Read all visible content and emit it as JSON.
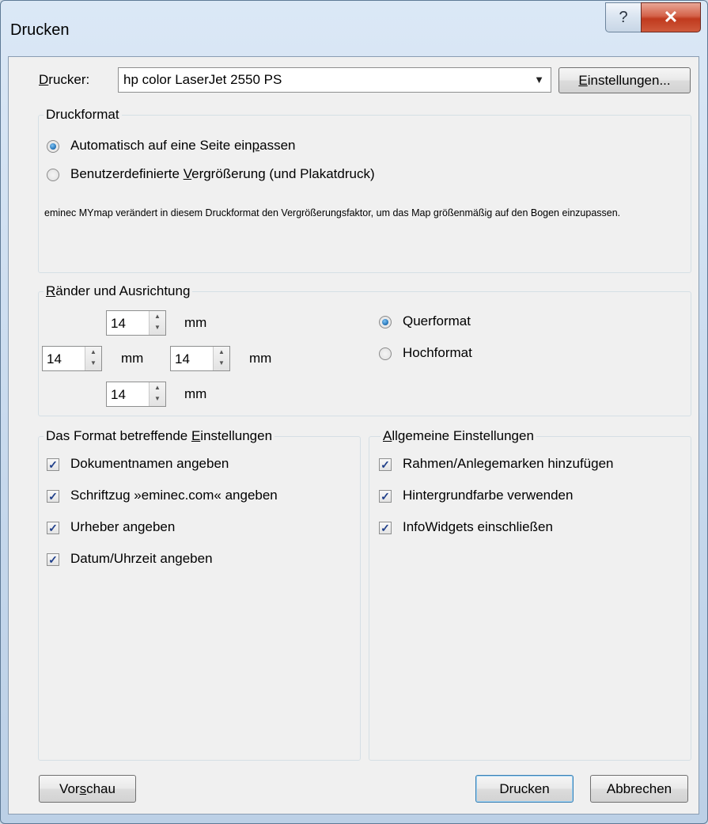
{
  "window": {
    "title": "Drucken",
    "help_glyph": "?",
    "close_glyph": "✕"
  },
  "printer": {
    "label_u": "D",
    "label_rest": "rucker:",
    "selected": "hp color LaserJet 2550 PS",
    "settings_u": "E",
    "settings_rest": "instellungen..."
  },
  "druckformat": {
    "title": "Druckformat",
    "opt1_pre": "Automatisch auf eine Seite ein",
    "opt1_u": "p",
    "opt1_post": "assen",
    "opt2_pre": "Benutzerdefinierte ",
    "opt2_u": "V",
    "opt2_post": "ergrößerung (und Plakatdruck)",
    "selected": "Automatisch auf eine Seite einpassen",
    "description": "eminec MYmap verändert in diesem Druckformat den Vergrößerungsfaktor, um das Map größenmäßig auf den Bogen einzupassen."
  },
  "margins": {
    "title_u": "R",
    "title_rest": "änder und Ausrichtung",
    "top": "14",
    "left": "14",
    "right": "14",
    "bottom": "14",
    "unit": "mm",
    "landscape": "Querformat",
    "portrait": "Hochformat",
    "orientation_selected": "Querformat"
  },
  "format_settings": {
    "title_pre": "Das Format betreffende ",
    "title_u": "E",
    "title_post": "instellungen",
    "items": [
      {
        "label": "Dokumentnamen angeben",
        "checked": true
      },
      {
        "label": "Schriftzug »eminec.com« angeben",
        "checked": true
      },
      {
        "label": "Urheber angeben",
        "checked": true
      },
      {
        "label": "Datum/Uhrzeit angeben",
        "checked": true
      }
    ]
  },
  "general_settings": {
    "title_u": "A",
    "title_rest": "llgemeine Einstellungen",
    "items": [
      {
        "label": "Rahmen/Anlegemarken hinzufügen",
        "checked": true
      },
      {
        "label": "Hintergrundfarbe verwenden",
        "checked": true
      },
      {
        "label": "InfoWidgets einschließen",
        "checked": true
      }
    ]
  },
  "buttons": {
    "preview_pre": "Vor",
    "preview_u": "s",
    "preview_post": "chau",
    "print": "Drucken",
    "cancel": "Abbrechen"
  },
  "check_glyph": "✓"
}
